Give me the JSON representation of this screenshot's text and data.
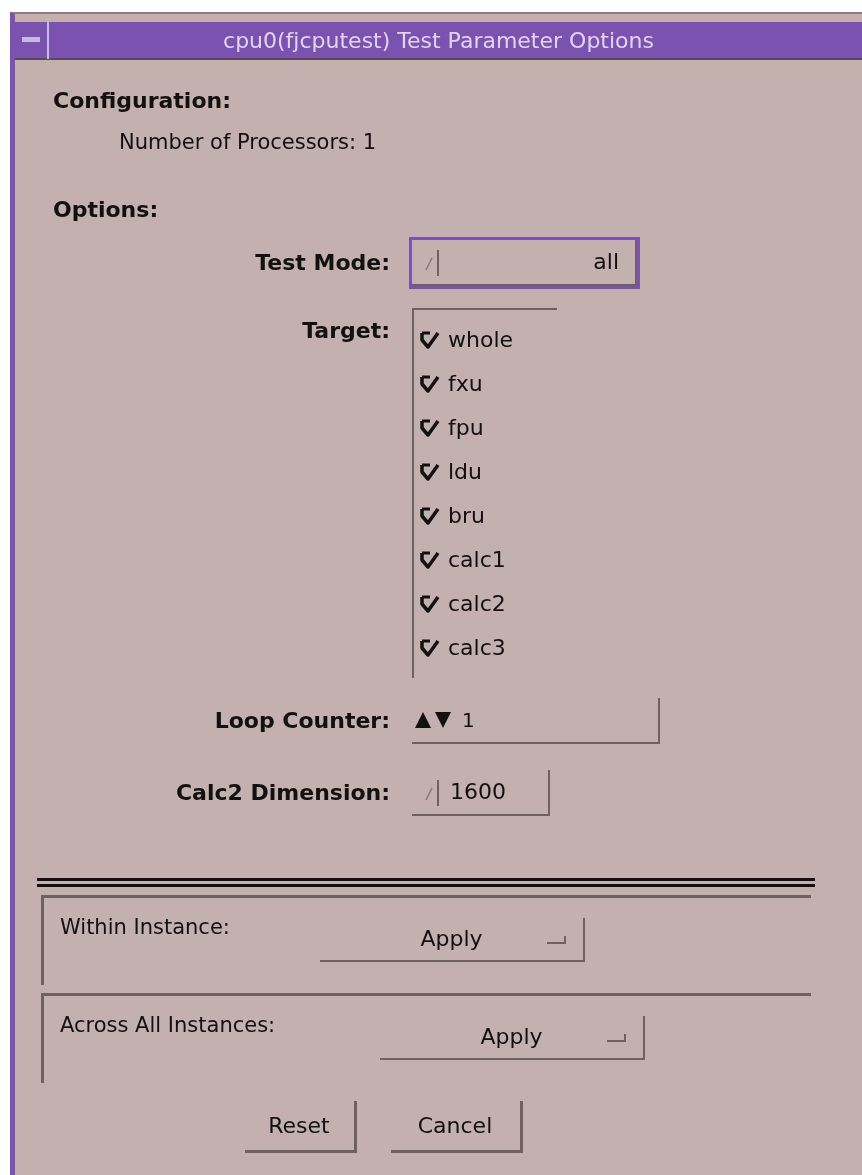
{
  "window": {
    "title": "cpu0(fjcputest) Test Parameter Options"
  },
  "configuration": {
    "heading": "Configuration:",
    "processors": "Number of Processors: 1"
  },
  "options": {
    "heading": "Options:",
    "test_mode": {
      "label": "Test Mode:",
      "value": "all",
      "focused": true
    },
    "target": {
      "label": "Target:",
      "items": [
        {
          "label": "whole",
          "checked": true
        },
        {
          "label": "fxu",
          "checked": true
        },
        {
          "label": "fpu",
          "checked": true
        },
        {
          "label": "ldu",
          "checked": true
        },
        {
          "label": "bru",
          "checked": true
        },
        {
          "label": "calc1",
          "checked": true
        },
        {
          "label": "calc2",
          "checked": true
        },
        {
          "label": "calc3",
          "checked": true
        }
      ]
    },
    "loop_counter": {
      "label": "Loop Counter:",
      "value": "1"
    },
    "calc2_dimension": {
      "label": "Calc2 Dimension:",
      "value": "1600"
    }
  },
  "apply_groups": [
    {
      "label": "Within Instance:",
      "button": "Apply"
    },
    {
      "label": "Across All Instances:",
      "button": "Apply"
    }
  ],
  "buttons": [
    "Reset",
    "Cancel"
  ]
}
